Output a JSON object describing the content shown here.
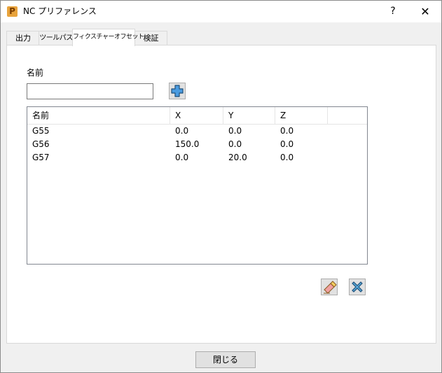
{
  "window": {
    "title": "NC プリファレンス",
    "help_label": "?",
    "close_label": "✕",
    "app_icon_letter": "P"
  },
  "tabs": [
    {
      "label": "出力"
    },
    {
      "label": "ツールパス"
    },
    {
      "label": "フィクスチャーオフセット",
      "active": true
    },
    {
      "label": "検証"
    }
  ],
  "form": {
    "name_label": "名前",
    "name_value": "",
    "add_button": "plus-icon"
  },
  "table": {
    "columns": [
      "名前",
      "X",
      "Y",
      "Z"
    ],
    "rows": [
      [
        "G55",
        "0.0",
        "0.0",
        "0.0"
      ],
      [
        "G56",
        "150.0",
        "0.0",
        "0.0"
      ],
      [
        "G57",
        "0.0",
        "20.0",
        "0.0"
      ]
    ]
  },
  "actions": {
    "edit_icon": "eraser-icon",
    "delete_icon": "delete-icon"
  },
  "footer": {
    "close_label": "閉じる"
  },
  "colors": {
    "plus_fill": "#4a9be0",
    "plus_stroke": "#1f4f7a",
    "delete_fill": "#5aa9d6",
    "eraser_pink": "#f0a0a0",
    "eraser_yellow": "#f5d060"
  }
}
